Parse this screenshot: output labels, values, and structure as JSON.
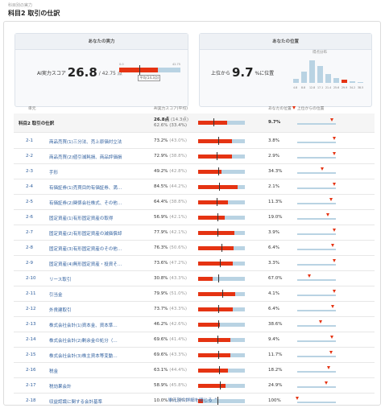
{
  "breadcrumb": "科目別の実力",
  "page_title": "科目2 取引の仕訳",
  "card_left": {
    "title": "あなたの実力",
    "label": "AI実力スコア",
    "score": "26.8",
    "unit_pre": "/ 42.75 点",
    "bar_min": "0.0",
    "bar_max": "42.75",
    "avg_label": "平均(14.3点)",
    "score_fraction": 0.627,
    "avg_fraction": 0.334
  },
  "card_right": {
    "title": "あなたの位置",
    "prefix": "上位から",
    "value": "9.7",
    "suffix": "%に位置",
    "hist_title": "得点分布",
    "hist": [
      {
        "label": "4.8",
        "value": 0.17,
        "me": false
      },
      {
        "label": "8.8",
        "value": 0.48,
        "me": false
      },
      {
        "label": "12.8",
        "value": 0.92,
        "me": false
      },
      {
        "label": "17.1",
        "value": 0.7,
        "me": false
      },
      {
        "label": "21.4",
        "value": 0.38,
        "me": false
      },
      {
        "label": "25.6",
        "value": 0.2,
        "me": false
      },
      {
        "label": "29.9",
        "value": 0.14,
        "me": true
      },
      {
        "label": "34.2",
        "value": 0.08,
        "me": false
      },
      {
        "label": "38.5",
        "value": 0.04,
        "me": false
      }
    ]
  },
  "columns": {
    "unit": "単元",
    "score": "AI実力スコア",
    "score_sub": "(平均)",
    "pos": "あなたの位置",
    "legend": "上位からの位置"
  },
  "total_row": {
    "name": "科目2 取引の仕訳",
    "score": "26.8点",
    "avg": "(14.3点)",
    "pct_line": "62.6% (33.4%)",
    "pos": "9.7%",
    "fill": 0.626,
    "avg_pos": 0.334,
    "rank": 0.097
  },
  "rows": [
    {
      "code": "2-1",
      "name": "商品売買(1)三分法、売上原価対立法",
      "score": "73.2%",
      "avg": "(43.0%)",
      "pos": "3.8%",
      "fill": 0.732,
      "avgp": 0.43,
      "rank": 0.038
    },
    {
      "code": "2-2",
      "name": "商品売買(2)値引減耗損、商品評価損",
      "score": "72.9%",
      "avg": "(38.8%)",
      "pos": "2.9%",
      "fill": 0.729,
      "avgp": 0.388,
      "rank": 0.029
    },
    {
      "code": "2-3",
      "name": "手形",
      "score": "49.2%",
      "avg": "(42.8%)",
      "pos": "34.3%",
      "fill": 0.492,
      "avgp": 0.428,
      "rank": 0.343
    },
    {
      "code": "2-4",
      "name": "有価証券(1)売買目的有価証券、満…",
      "score": "84.5%",
      "avg": "(44.2%)",
      "pos": "2.1%",
      "fill": 0.845,
      "avgp": 0.442,
      "rank": 0.021
    },
    {
      "code": "2-5",
      "name": "有価証券(2)関係会社株式、その他…",
      "score": "64.4%",
      "avg": "(38.8%)",
      "pos": "11.3%",
      "fill": 0.644,
      "avgp": 0.388,
      "rank": 0.113
    },
    {
      "code": "2-6",
      "name": "固定資産(1)有形固定資産の取得",
      "score": "56.9%",
      "avg": "(42.1%)",
      "pos": "19.0%",
      "fill": 0.569,
      "avgp": 0.421,
      "rank": 0.19
    },
    {
      "code": "2-7",
      "name": "固定資産(2)有形固定資産の減価償却",
      "score": "77.9%",
      "avg": "(42.1%)",
      "pos": "3.9%",
      "fill": 0.779,
      "avgp": 0.421,
      "rank": 0.039
    },
    {
      "code": "2-8",
      "name": "固定資産(3)有形固定資産のその他…",
      "score": "76.3%",
      "avg": "(50.6%)",
      "pos": "6.4%",
      "fill": 0.763,
      "avgp": 0.506,
      "rank": 0.064
    },
    {
      "code": "2-9",
      "name": "固定資産(4)無形固定資産・投資そ…",
      "score": "73.6%",
      "avg": "(47.2%)",
      "pos": "3.3%",
      "fill": 0.736,
      "avgp": 0.472,
      "rank": 0.033
    },
    {
      "code": "2-10",
      "name": "リース取引",
      "score": "30.8%",
      "avg": "(43.3%)",
      "pos": "67.0%",
      "fill": 0.308,
      "avgp": 0.433,
      "rank": 0.67
    },
    {
      "code": "2-11",
      "name": "引当金",
      "score": "79.9%",
      "avg": "(51.0%)",
      "pos": "4.1%",
      "fill": 0.799,
      "avgp": 0.51,
      "rank": 0.041
    },
    {
      "code": "2-12",
      "name": "外貨建取引",
      "score": "73.7%",
      "avg": "(43.3%)",
      "pos": "6.4%",
      "fill": 0.737,
      "avgp": 0.433,
      "rank": 0.064
    },
    {
      "code": "2-13",
      "name": "株式会社会計(1)資本金、資本準…",
      "score": "46.2%",
      "avg": "(42.6%)",
      "pos": "38.6%",
      "fill": 0.462,
      "avgp": 0.426,
      "rank": 0.386
    },
    {
      "code": "2-14",
      "name": "株式会社会計(2)剰余金の処分（…",
      "score": "69.6%",
      "avg": "(41.4%)",
      "pos": "9.4%",
      "fill": 0.696,
      "avgp": 0.414,
      "rank": 0.094
    },
    {
      "code": "2-15",
      "name": "株式会社会計(3)株主資本等変動…",
      "score": "69.6%",
      "avg": "(43.3%)",
      "pos": "11.7%",
      "fill": 0.696,
      "avgp": 0.433,
      "rank": 0.117
    },
    {
      "code": "2-16",
      "name": "税金",
      "score": "63.1%",
      "avg": "(44.4%)",
      "pos": "18.2%",
      "fill": 0.631,
      "avgp": 0.444,
      "rank": 0.182
    },
    {
      "code": "2-17",
      "name": "税効果会計",
      "score": "58.9%",
      "avg": "(45.8%)",
      "pos": "24.9%",
      "fill": 0.589,
      "avgp": 0.458,
      "rank": 0.249
    },
    {
      "code": "2-18",
      "name": "収益認識に関する会計基準",
      "score": "10.0%",
      "avg": "(41.9%)",
      "pos": "100%",
      "fill": 0.1,
      "avgp": 0.419,
      "rank": 1.0
    }
  ],
  "more_link": "単元別の詳細を閉じる",
  "colors": {
    "accent": "#e53312",
    "bar_bg": "#b9d3e3",
    "link": "#2f5f9e"
  }
}
